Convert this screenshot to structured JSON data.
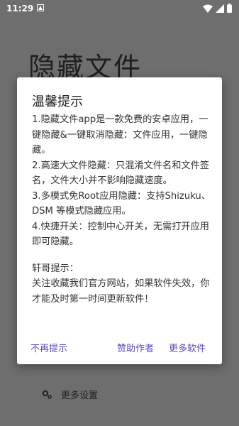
{
  "status_bar": {
    "time": "11:29"
  },
  "page": {
    "title": "隐藏文件"
  },
  "bottom_menu": {
    "more_settings_label": "更多设置"
  },
  "dialog": {
    "title": "温馨提示",
    "items": [
      "1.隐藏文件app是一款免费的安卓应用，一键隐藏&一键取消隐藏：文件应用，一键隐藏。",
      "2.高速大文件隐藏：只混淆文件名和文件签名，文件大小并不影响隐藏速度。",
      "3.多模式免Root应用隐藏：支持Shizuku、DSM 等模式隐藏应用。",
      "4.快捷开关：控制中心开关，无需打开应用即可隐藏。"
    ],
    "note_title": "轩哥提示：",
    "note_text": "关注收藏我们官方网站，如果软件失效，你才能及时第一时间更新软件！",
    "buttons": {
      "dismiss": "不再提示",
      "sponsor": "赞助作者",
      "more": "更多软件"
    }
  },
  "colors": {
    "accent": "#5b4cc4",
    "scrim_background": "#6e6e6e"
  }
}
